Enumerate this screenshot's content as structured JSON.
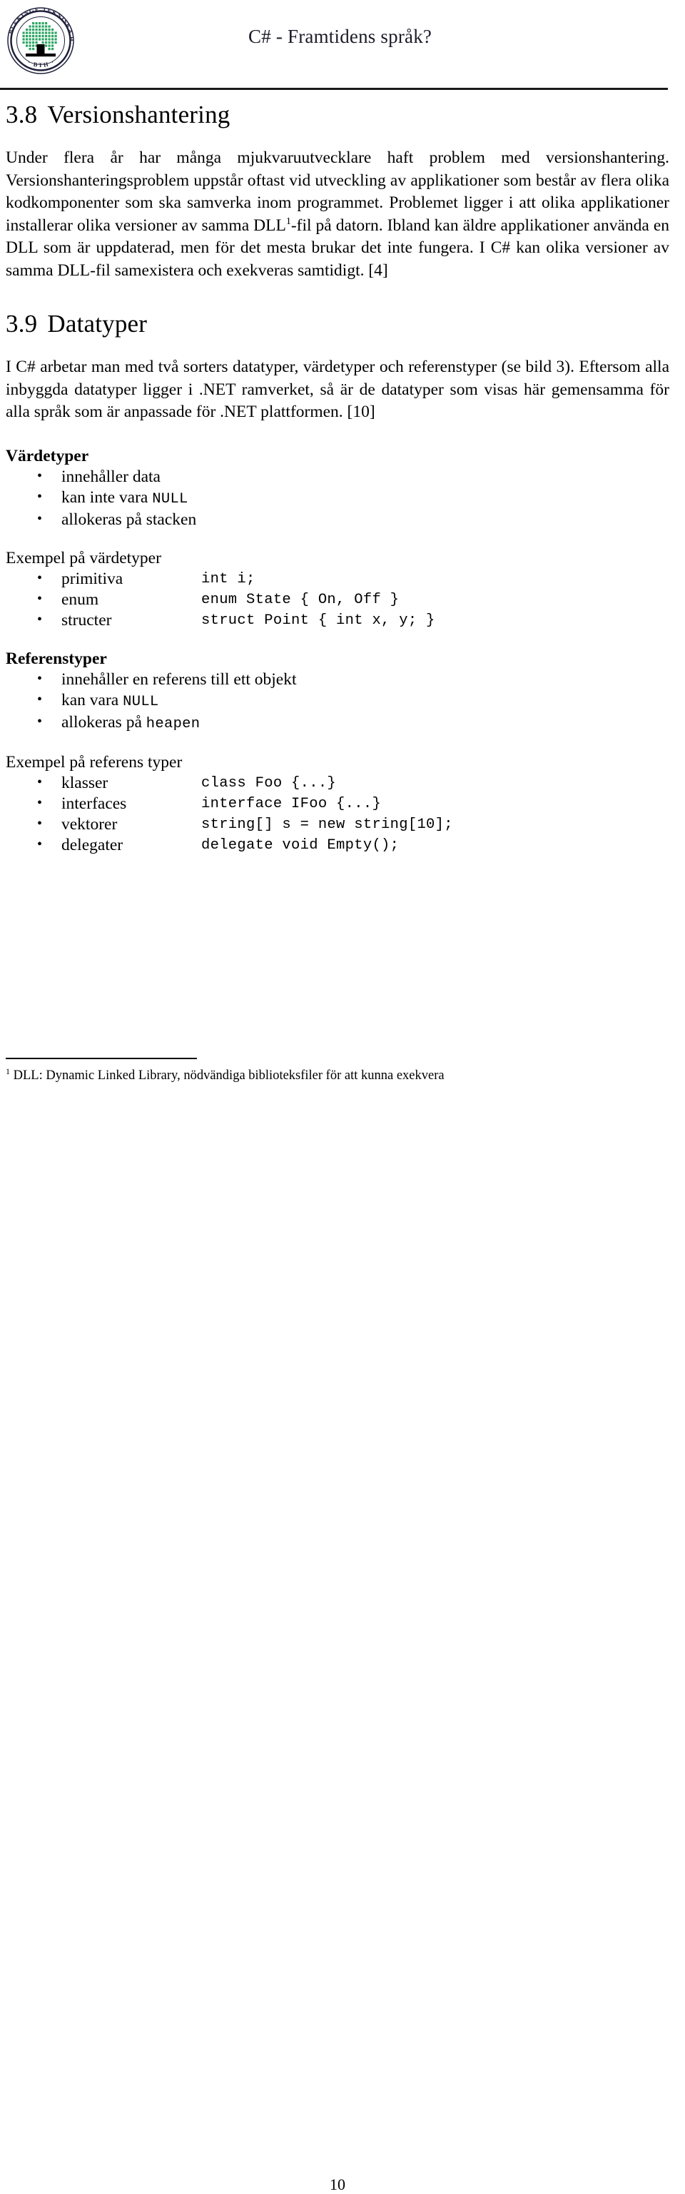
{
  "header": {
    "logo_alt": "Blekinge Tekniska Högskola BTH seal",
    "logo_ring_top": "BLEKINGE TEKNISKA HÖGSKOLA",
    "logo_ring_bottom": "· BTH ·",
    "title": "C# - Framtidens språk?",
    "title_color": "#1b1b28",
    "logo_green": "#2ea565"
  },
  "sections": [
    {
      "number": "3.8",
      "title": "Versionshantering",
      "paragraph_part1": "Under flera år har många mjukvaruutvecklare haft problem med versionshantering. Versionshanteringsproblem uppstår oftast vid utveckling av applikationer som består av flera olika kodkomponenter som ska samverka inom programmet. Problemet ligger i att olika applikationer installerar olika versioner av samma DLL",
      "footnote_marker": "1",
      "paragraph_part2": "-fil på datorn. Ibland kan äldre applikationer använda en DLL som är uppdaterad, men för det mesta brukar det inte fungera. I C# kan olika versioner av samma DLL-fil samexistera och exekveras samtidigt. [4]"
    },
    {
      "number": "3.9",
      "title": "Datatyper",
      "paragraph": "I C# arbetar man med två sorters datatyper, värdetyper och referenstyper (se bild 3). Eftersom alla inbyggda datatyper ligger i .NET ramverket, så är de datatyper som visas här gemensamma för alla språk som är anpassade för .NET plattformen. [10]"
    }
  ],
  "value_types": {
    "heading": "Värdetyper",
    "bullets": [
      {
        "text_before": "innehåller data",
        "code": "",
        "text_after": ""
      },
      {
        "text_before": "kan inte vara ",
        "code": "NULL",
        "text_after": ""
      },
      {
        "text_before": "allokeras på stacken",
        "code": "",
        "text_after": ""
      }
    ]
  },
  "value_examples": {
    "heading": "Exempel på värdetyper",
    "rows": [
      {
        "label": "primitiva",
        "code": "int i;"
      },
      {
        "label": "enum",
        "code": "enum State { On, Off }"
      },
      {
        "label": "structer",
        "code": "struct Point { int x, y; }"
      }
    ]
  },
  "reference_types": {
    "heading": "Referenstyper",
    "bullets": [
      {
        "text_before": "innehåller en referens till ett objekt",
        "code": "",
        "text_after": ""
      },
      {
        "text_before": "kan vara ",
        "code": "NULL",
        "text_after": ""
      },
      {
        "text_before": "allokeras på ",
        "code": "heapen",
        "text_after": ""
      }
    ]
  },
  "reference_examples": {
    "heading": "Exempel på referens typer",
    "rows": [
      {
        "label": "klasser",
        "code": "class Foo {...}"
      },
      {
        "label": "interfaces",
        "code": "interface IFoo {...}"
      },
      {
        "label": "vektorer",
        "code": "string[] s = new string[10];"
      },
      {
        "label": "delegater",
        "code": "delegate void Empty();"
      }
    ]
  },
  "footnote": {
    "marker": "1",
    "text": " DLL: Dynamic Linked Library, nödvändiga biblioteksfiler för att kunna exekvera"
  },
  "page_number": "10"
}
